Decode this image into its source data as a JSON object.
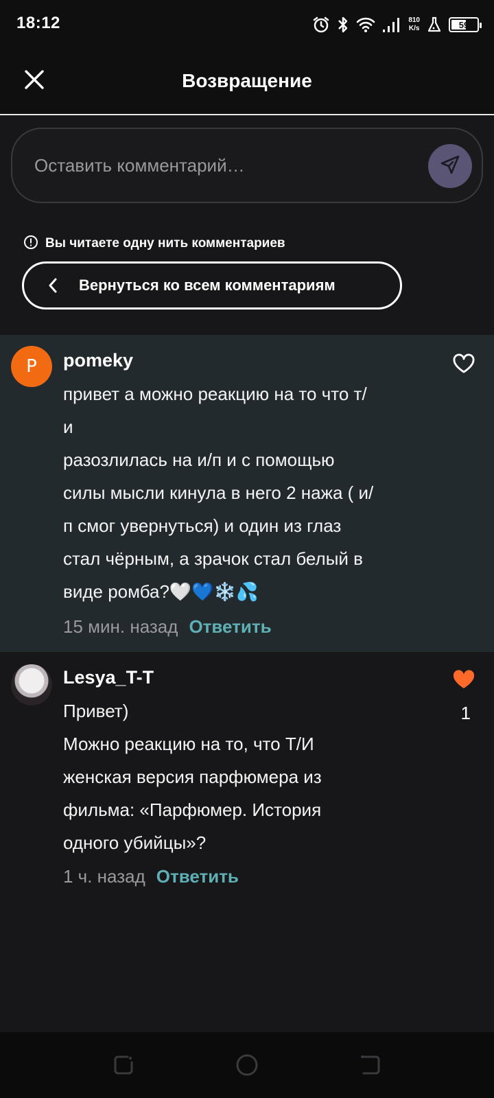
{
  "status_bar": {
    "time": "18:12",
    "net_speed_value": "810",
    "net_speed_unit": "K/s",
    "battery_level": "59",
    "battery_fraction": 0.59
  },
  "header": {
    "title": "Возвращение",
    "close_icon": "close-icon"
  },
  "comment_input": {
    "placeholder": "Оставить комментарий…",
    "send_icon": "send-icon",
    "send_button_color": "#5a5475"
  },
  "thread": {
    "notice": "Вы читаете одну нить комментариев",
    "back_button_label": "Вернуться ко всем комментариям"
  },
  "comments": [
    {
      "avatar_letter": "P",
      "avatar_color": "#f26b12",
      "username": "pomeky",
      "lines": [
        "привет а можно реакцию на то что т/",
        "и",
        "разозлилась на и/п и с помощью",
        "силы мысли кинула в него 2 нажа ( и/",
        "п смог увернуться) и один из глаз",
        "стал чёрным, а зрачок стал белый в",
        "виде ромба?🤍💙❄️💦"
      ],
      "time": "15 мин. назад",
      "reply_label": "Ответить",
      "liked": false,
      "like_count": ""
    },
    {
      "avatar_letter": "",
      "username": "Lesya_T-T",
      "lines": [
        "Привет)",
        "Можно реакцию на то, что Т/И",
        "женская версия парфюмера из",
        "фильма: «Парфюмер. История",
        "одного убийцы»?"
      ],
      "time": "1 ч. назад",
      "reply_label": "Ответить",
      "liked": true,
      "like_count": "1",
      "like_color": "#ff6a2b"
    }
  ],
  "colors": {
    "background": "#171719",
    "highlight": "#232a2e",
    "accent_link": "#5fb0b5"
  }
}
